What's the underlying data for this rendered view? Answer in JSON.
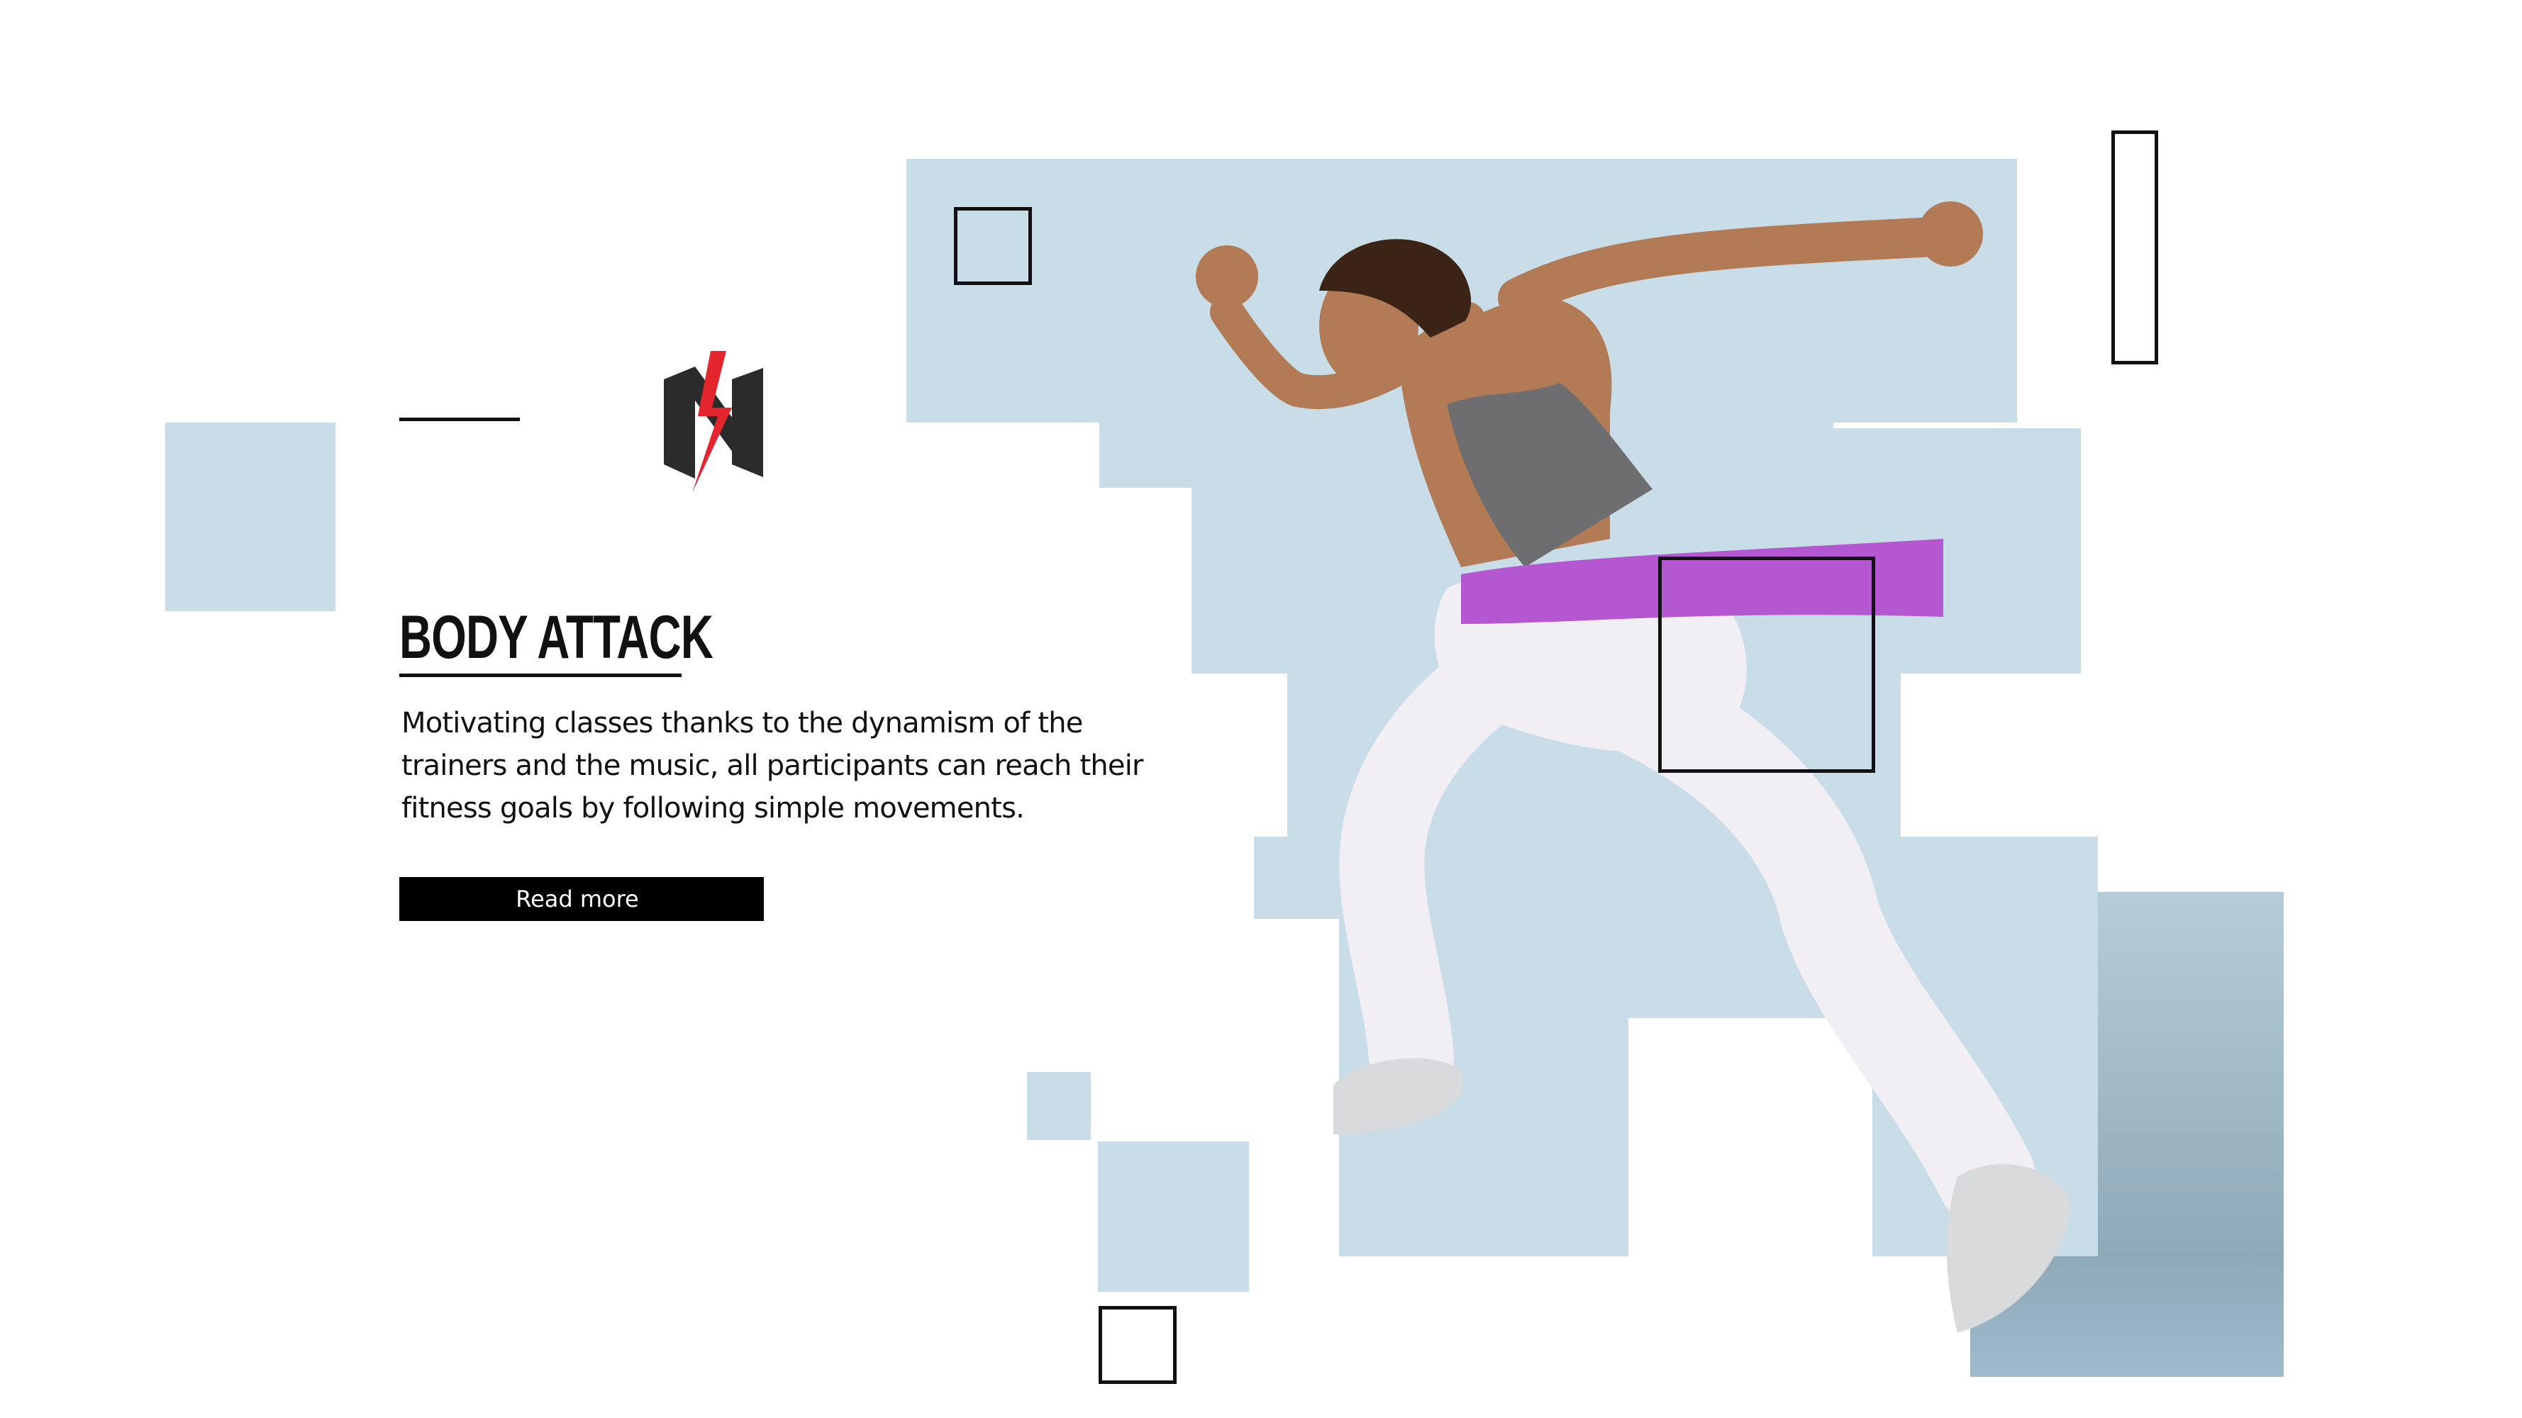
{
  "hero": {
    "title": "BODY ATTACK",
    "description": "Motivating classes thanks to the dynamism of the trainers and the music, all participants can reach their fitness goals by following simple movements.",
    "read_more_label": "Read more"
  },
  "logo": {
    "icon": "lightning-n-logo-icon",
    "dark_color": "#2b2b2b",
    "bolt_color": "#e3262e"
  },
  "colors": {
    "tile": "#c8dde7",
    "tile_dark": "#9fb9c6",
    "outline": "#111111",
    "band": "#b657d2",
    "top": "#6e6e70",
    "leggings": "#f1eef4",
    "skin": "#b27a55",
    "hair": "#3b2416"
  },
  "photo": {
    "subject": "woman-running-with-resistance-band"
  }
}
